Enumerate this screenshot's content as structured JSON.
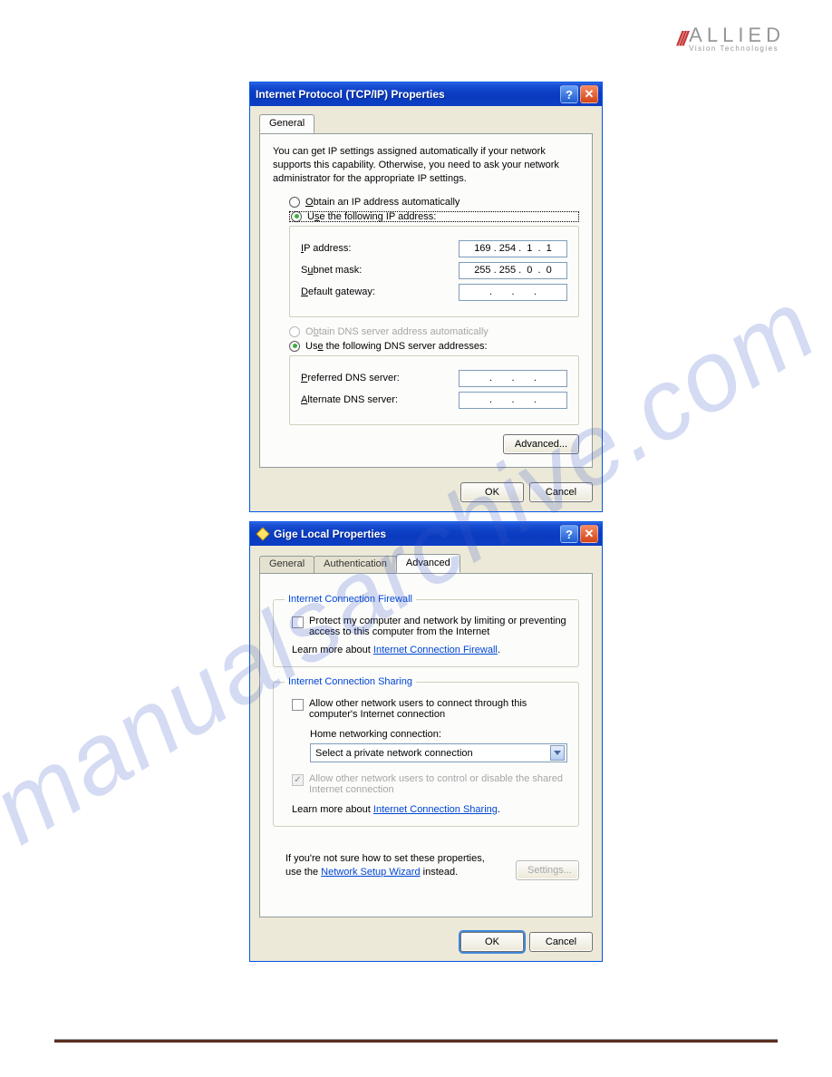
{
  "logo": {
    "slashes": "///",
    "main": "ALLIED",
    "sub": "Vision Technologies"
  },
  "watermark": "manualsarchive.com",
  "dialog1": {
    "title": "Internet Protocol (TCP/IP) Properties",
    "tab_general": "General",
    "instructions": "You can get IP settings assigned automatically if your network supports this capability. Otherwise, you need to ask your network administrator for the appropriate IP settings.",
    "radio_auto_ip": "Obtain an IP address automatically",
    "radio_use_ip": "Use the following IP address:",
    "lbl_ip": "IP address:",
    "val_ip": "169 . 254 .  1  .  1",
    "lbl_subnet": "Subnet mask:",
    "val_subnet": "255 . 255 .  0  .  0",
    "lbl_gateway": "Default gateway:",
    "val_gateway": ".       .       .",
    "radio_auto_dns": "Obtain DNS server address automatically",
    "radio_use_dns": "Use the following DNS server addresses:",
    "lbl_pref_dns": "Preferred DNS server:",
    "val_pref_dns": ".       .       .",
    "lbl_alt_dns": "Alternate DNS server:",
    "val_alt_dns": ".       .       .",
    "btn_advanced": "Advanced...",
    "btn_ok": "OK",
    "btn_cancel": "Cancel"
  },
  "dialog2": {
    "title": "Gige Local Properties",
    "tabs": {
      "general": "General",
      "auth": "Authentication",
      "advanced": "Advanced"
    },
    "fs_firewall": "Internet Connection Firewall",
    "chk_firewall": "Protect my computer and network by limiting or preventing access to this computer from the Internet",
    "learn_firewall_pre": "Learn more about ",
    "learn_firewall_link": "Internet Connection Firewall",
    "fs_sharing": "Internet Connection Sharing",
    "chk_sharing_allow": "Allow other network users to connect through this computer's Internet connection",
    "lbl_home_net": "Home networking connection:",
    "sel_home_net": "Select a private network connection",
    "chk_sharing_control": "Allow other network users to control or disable the shared Internet connection",
    "learn_sharing_pre": "Learn more about ",
    "learn_sharing_link": "Internet Connection Sharing",
    "wizard_pre": "If you're not sure how to set these properties, use the ",
    "wizard_link": "Network Setup Wizard",
    "wizard_post": " instead.",
    "btn_settings": "Settings...",
    "btn_ok": "OK",
    "btn_cancel": "Cancel"
  }
}
